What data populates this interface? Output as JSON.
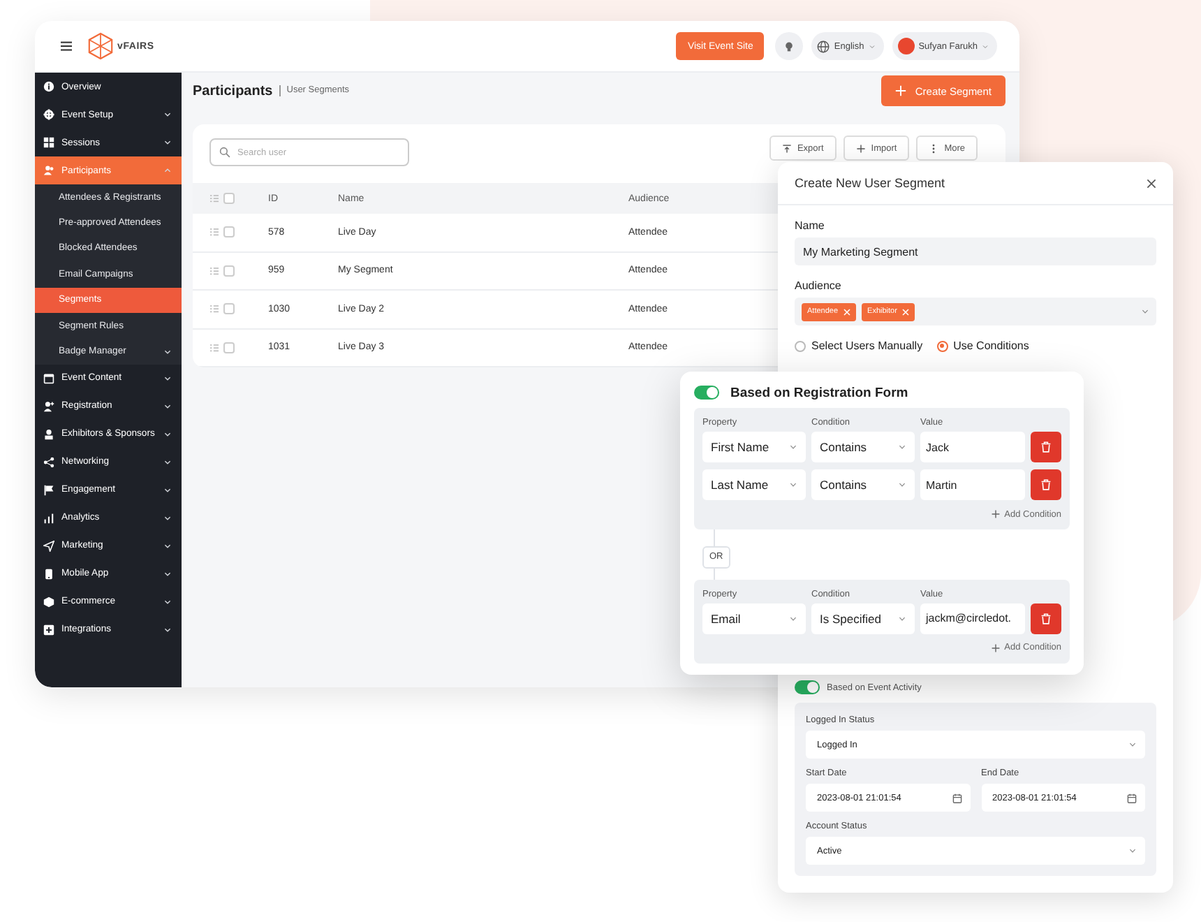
{
  "topbar": {
    "logo": "vFAIRS",
    "visit_button": "Visit Event Site",
    "language": "English",
    "user_name": "Sufyan Farukh"
  },
  "sidebar": {
    "items": [
      {
        "label": "Overview",
        "kind": "link",
        "selected": false
      },
      {
        "label": "Event Setup",
        "kind": "group",
        "expanded": false,
        "selected": false
      },
      {
        "label": "Sessions",
        "kind": "group",
        "expanded": false,
        "selected": false
      },
      {
        "label": "Participants",
        "kind": "group",
        "expanded": true,
        "selected": true,
        "children": [
          {
            "label": "Attendees & Registrants",
            "kind": "link",
            "selected": false
          },
          {
            "label": "Pre-approved Attendees",
            "kind": "link",
            "selected": false
          },
          {
            "label": "Blocked Attendees",
            "kind": "link",
            "selected": false
          },
          {
            "label": "Email Campaigns",
            "kind": "link",
            "selected": false
          },
          {
            "label": "Segments",
            "kind": "link",
            "selected": true
          },
          {
            "label": "Segment Rules",
            "kind": "link",
            "selected": false
          },
          {
            "label": "Badge Manager",
            "kind": "group",
            "expanded": false,
            "selected": false
          }
        ]
      },
      {
        "label": "Event Content",
        "kind": "group",
        "expanded": false,
        "selected": false
      },
      {
        "label": "Registration",
        "kind": "group",
        "expanded": false,
        "selected": false
      },
      {
        "label": "Exhibitors & Sponsors",
        "kind": "group",
        "expanded": false,
        "selected": false
      },
      {
        "label": "Networking",
        "kind": "group",
        "expanded": false,
        "selected": false
      },
      {
        "label": "Engagement",
        "kind": "group",
        "expanded": false,
        "selected": false
      },
      {
        "label": "Analytics",
        "kind": "group",
        "expanded": false,
        "selected": false
      },
      {
        "label": "Marketing",
        "kind": "group",
        "expanded": false,
        "selected": false
      },
      {
        "label": "Mobile App",
        "kind": "group",
        "expanded": false,
        "selected": false
      },
      {
        "label": "E-commerce",
        "kind": "group",
        "expanded": false,
        "selected": false
      },
      {
        "label": "Integrations",
        "kind": "group",
        "expanded": false,
        "selected": false
      }
    ]
  },
  "page": {
    "title": "Participants",
    "breadcrumb": "User Segments",
    "create_button": "Create Segment"
  },
  "toolbar": {
    "search": {
      "placeholder": "Search user"
    },
    "buttons": [
      "Export",
      "Import",
      "More"
    ]
  },
  "table": {
    "header_checked": false,
    "columns": [
      "ID",
      "Name",
      "Audience"
    ],
    "rows": [
      {
        "cells": [
          "578",
          "Live Day",
          "Attendee"
        ],
        "checked": false
      },
      {
        "cells": [
          "959",
          "My Segment",
          "Attendee"
        ],
        "checked": false
      },
      {
        "cells": [
          "1030",
          "Live Day 2",
          "Attendee"
        ],
        "checked": false
      },
      {
        "cells": [
          "1031",
          "Live Day 3",
          "Attendee"
        ],
        "checked": false
      }
    ]
  },
  "modal": {
    "title": "Create New User Segment",
    "name_label": "Name",
    "name_value": "My Marketing Segment",
    "audience_label": "Audience",
    "audience_tags": [
      "Attendee",
      "Exhibitor"
    ],
    "modes": [
      {
        "label": "Select Users Manually",
        "selected": false
      },
      {
        "label": "Use Conditions",
        "selected": true
      }
    ]
  },
  "registration_form": {
    "title": "Based on Registration Form",
    "on": true,
    "joiner": "OR",
    "groups": [
      {
        "headers": [
          "Property",
          "Condition",
          "Value"
        ],
        "add_label": "Add Condition",
        "conditions": [
          {
            "property": "First Name",
            "condition": "Contains",
            "value": "Jack"
          },
          {
            "property": "Last Name",
            "condition": "Contains",
            "value": "Martin"
          }
        ]
      },
      {
        "headers": [
          "Property",
          "Condition",
          "Value"
        ],
        "add_label": "Add Condition",
        "conditions": [
          {
            "property": "Email",
            "condition": "Is Specified",
            "value": "jackm@circledot."
          }
        ]
      }
    ]
  },
  "event_activity": {
    "title": "Based on Event Activity",
    "on": true,
    "logged_in_label": "Logged In Status",
    "logged_in_value": "Logged In",
    "start_label": "Start Date",
    "start_value": "2023-08-01 21:01:54",
    "end_label": "End Date",
    "end_value": "2023-08-01 21:01:54",
    "account_label": "Account Status",
    "account_value": "Active"
  }
}
